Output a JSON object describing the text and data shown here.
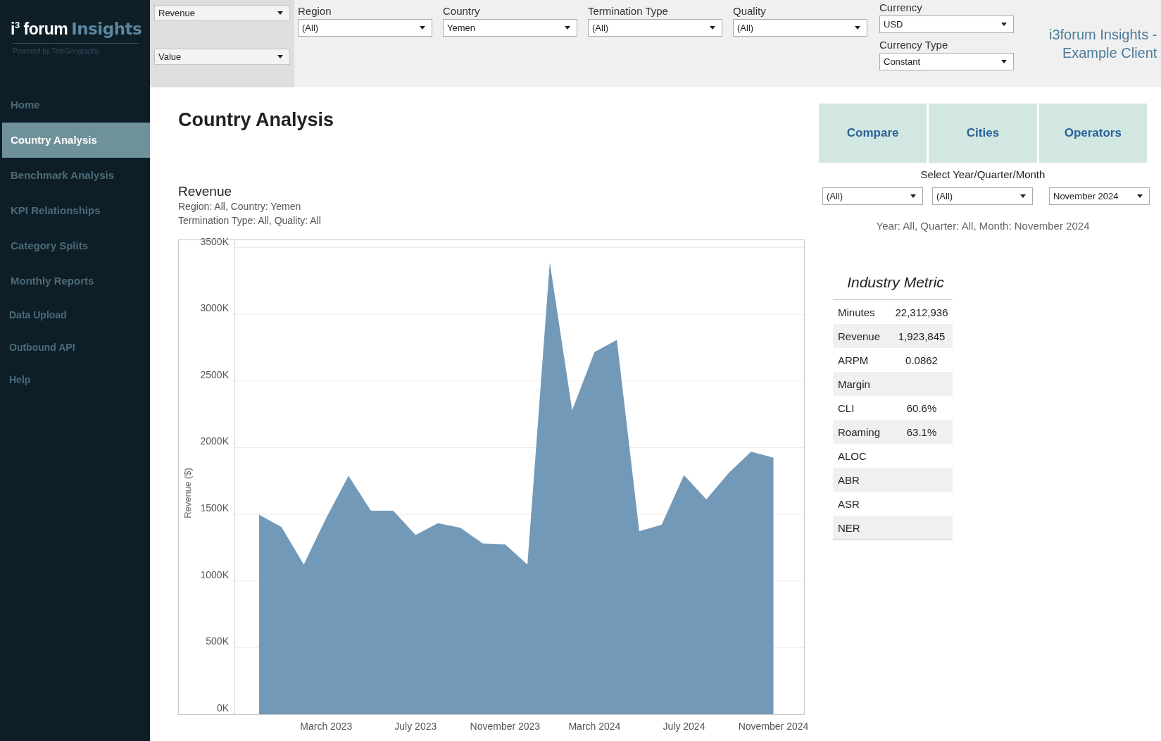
{
  "logo": {
    "brand": "i$^{3}$ forum",
    "accent": "Insights",
    "tagline": "Powered by TeleGeography"
  },
  "sidebar": {
    "items": [
      {
        "label": "Home",
        "selected": false
      },
      {
        "label": "Country Analysis",
        "selected": true
      },
      {
        "label": "Benchmark Analysis",
        "selected": false
      },
      {
        "label": "KPI Relationships",
        "selected": false
      },
      {
        "label": "Category Splits",
        "selected": false
      },
      {
        "label": "Monthly Reports",
        "selected": false
      },
      {
        "label": "Data Upload",
        "selected": false
      },
      {
        "label": "Outbound API",
        "selected": false
      },
      {
        "label": "Help",
        "selected": false
      }
    ]
  },
  "measure_selects": [
    {
      "value": "Revenue"
    },
    {
      "value": "Value"
    }
  ],
  "filters": [
    {
      "label": "Region",
      "value": "(All)"
    },
    {
      "label": "Country",
      "value": "Yemen"
    },
    {
      "label": "Termination Type",
      "value": "(All)"
    },
    {
      "label": "Quality",
      "value": "(All)"
    }
  ],
  "currency_filters": [
    {
      "label": "Currency",
      "value": "USD"
    },
    {
      "label": "Currency Type",
      "value": "Constant"
    }
  ],
  "client_title": [
    "i3forum Insights -",
    "Example Client"
  ],
  "page_title": "Country Analysis",
  "chart": {
    "subtitle": [
      "Region: All, Country: Yemen",
      "Termination Type: All, Quality: All"
    ],
    "chart_data": {
      "type": "area",
      "title": "Revenue",
      "ylabel": "Revenue ($)",
      "categories": [
        null,
        null,
        null,
        "March 2023",
        null,
        null,
        null,
        "July 2023",
        null,
        null,
        null,
        "November 2023",
        null,
        null,
        null,
        "March 2024",
        null,
        null,
        null,
        "July 2024",
        null,
        null,
        null,
        "November 2024"
      ],
      "series": [
        {
          "color": "#7399b8",
          "values": [
            1497,
            1405,
            1123,
            1472,
            1788,
            1527,
            1527,
            1345,
            1433,
            1399,
            1281,
            1275,
            1123,
            3388,
            2280,
            2717,
            2808,
            1372,
            1421,
            1794,
            1612,
            1809,
            1970,
            1924
          ]
        }
      ],
      "ylim": [
        0,
        3561
      ],
      "grid": true,
      "yticks": [
        {
          "value": 0,
          "label": "0K"
        },
        {
          "value": 500,
          "label": "500K"
        },
        {
          "value": 1000,
          "label": "1000K"
        },
        {
          "value": 1500,
          "label": "1500K"
        },
        {
          "value": 2000,
          "label": "2000K"
        },
        {
          "value": 2500,
          "label": "2500K"
        },
        {
          "value": 3000,
          "label": "3000K"
        },
        {
          "value": 3500,
          "label": "3500K"
        }
      ]
    }
  },
  "nav_buttons": [
    "Compare",
    "Cities",
    "Operators"
  ],
  "period": {
    "label": "Select Year/Quarter/Month",
    "selects": [
      {
        "value": "(All)"
      },
      {
        "value": "(All)"
      },
      {
        "value": "November 2024"
      }
    ],
    "summary": "Year: All, Quarter: All, Month: November 2024"
  },
  "metrics": {
    "title": "Industry Metric",
    "rows": [
      {
        "name": "Minutes",
        "value": "22,312,936"
      },
      {
        "name": "Revenue",
        "value": "1,923,845"
      },
      {
        "name": "ARPM",
        "value": "0.0862"
      },
      {
        "name": "Margin"
      },
      {
        "name": "CLI",
        "value": "60.6%"
      },
      {
        "name": "Roaming",
        "value": "63.1%"
      },
      {
        "name": "ALOC"
      },
      {
        "name": "ABR"
      },
      {
        "name": "ASR"
      },
      {
        "name": "NER"
      }
    ]
  }
}
